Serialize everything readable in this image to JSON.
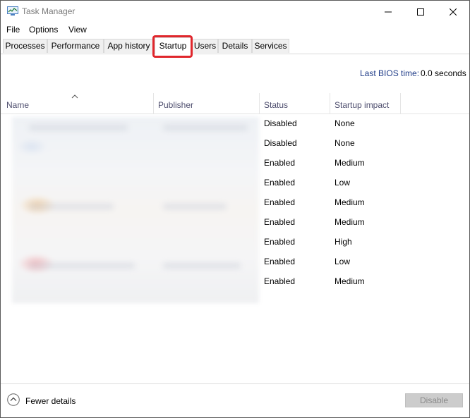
{
  "window": {
    "title": "Task Manager"
  },
  "menu": {
    "items": [
      "File",
      "Options",
      "View"
    ]
  },
  "tabs": [
    "Processes",
    "Performance",
    "App history",
    "Startup",
    "Users",
    "Details",
    "Services"
  ],
  "active_tab": "Startup",
  "bios": {
    "label": "Last BIOS time:",
    "value": "0.0 seconds"
  },
  "columns": {
    "name": "Name",
    "publisher": "Publisher",
    "status": "Status",
    "impact": "Startup impact"
  },
  "rows": [
    {
      "status": "Disabled",
      "impact": "None"
    },
    {
      "status": "Disabled",
      "impact": "None"
    },
    {
      "status": "Enabled",
      "impact": "Medium"
    },
    {
      "status": "Enabled",
      "impact": "Low"
    },
    {
      "status": "Enabled",
      "impact": "Medium"
    },
    {
      "status": "Enabled",
      "impact": "Medium"
    },
    {
      "status": "Enabled",
      "impact": "High"
    },
    {
      "status": "Enabled",
      "impact": "Low"
    },
    {
      "status": "Enabled",
      "impact": "Medium"
    }
  ],
  "footer": {
    "fewer_details": "Fewer details",
    "disable": "Disable"
  },
  "colors": {
    "highlight": "#e0262c",
    "bios_label": "#1f3c88",
    "disabled_button": "#cccccc"
  }
}
